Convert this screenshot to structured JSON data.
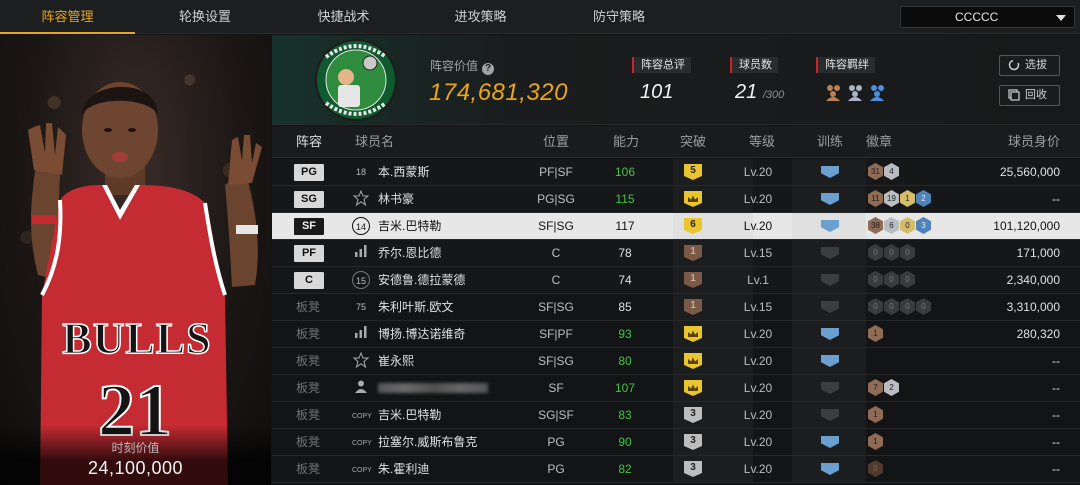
{
  "nav": {
    "tabs": [
      {
        "label": "阵容管理",
        "active": true
      },
      {
        "label": "轮换设置",
        "active": false
      },
      {
        "label": "快捷战术",
        "active": false
      },
      {
        "label": "进攻策略",
        "active": false
      },
      {
        "label": "防守策略",
        "active": false
      }
    ],
    "team_select": "CCCCC"
  },
  "player_card": {
    "jersey_number": "21",
    "team_word": "BULLS",
    "label": "时刻价值",
    "value": "24,100,000"
  },
  "header": {
    "value_label": "阵容价值",
    "team_value": "174,681,320",
    "overall_label": "阵容总评",
    "overall": "101",
    "players_label": "球员数",
    "players": "21",
    "players_max": "/300",
    "chemistry_label": "阵容羁绊",
    "pick_button": "选拔",
    "recycle_button": "回收",
    "accent_color": "#e9a51c"
  },
  "table": {
    "headers": [
      "阵容",
      "球员名",
      "位置",
      "能力",
      "突破",
      "等级",
      "训练",
      "徽章",
      "球员身价"
    ],
    "rows": [
      {
        "slot": "PG",
        "starter": true,
        "num": "18",
        "numStyle": "plain",
        "name": "本.西蒙斯",
        "pos": "PF|SF",
        "ability": "106",
        "abilityGreen": true,
        "bt": "5",
        "btColor": "gold",
        "level": "Lv.20",
        "train": "blue",
        "badges": [
          [
            "31",
            "bronze"
          ],
          [
            "4",
            "silver"
          ]
        ],
        "value": "25,560,000"
      },
      {
        "slot": "SG",
        "starter": true,
        "num": "star",
        "numStyle": "star",
        "name": "林书豪",
        "pos": "PG|SG",
        "ability": "115",
        "abilityGreen": true,
        "bt": "crown",
        "btColor": "gold",
        "level": "Lv.20",
        "train": "blue",
        "badges": [
          [
            "11",
            "bronze"
          ],
          [
            "19",
            "silver"
          ],
          [
            "1",
            "gold"
          ],
          [
            "2",
            "blue"
          ]
        ],
        "value": "--"
      },
      {
        "slot": "SF",
        "starter": true,
        "selected": true,
        "num": "14",
        "numStyle": "circle",
        "name": "吉米.巴特勒",
        "pos": "SF|SG",
        "ability": "117",
        "abilityGreen": false,
        "bt": "6",
        "btColor": "gold",
        "level": "Lv.20",
        "train": "blue",
        "badges": [
          [
            "38",
            "bronze"
          ],
          [
            "6",
            "silver"
          ],
          [
            "0",
            "gold"
          ],
          [
            "3",
            "blue"
          ]
        ],
        "value": "101,120,000"
      },
      {
        "slot": "PF",
        "starter": true,
        "num": "bars",
        "numStyle": "bars",
        "name": "乔尔.恩比德",
        "pos": "C",
        "ability": "78",
        "abilityGreen": false,
        "bt": "1",
        "btColor": "brown",
        "level": "Lv.15",
        "train": "dim",
        "badges": [
          [
            "0",
            "dark"
          ],
          [
            "0",
            "dark"
          ],
          [
            "0",
            "dark"
          ]
        ],
        "value": "171,000"
      },
      {
        "slot": "C",
        "starter": true,
        "num": "15",
        "numStyle": "circle",
        "name": "安德鲁.德拉蒙德",
        "pos": "C",
        "ability": "74",
        "abilityGreen": false,
        "bt": "1",
        "btColor": "brown",
        "level": "Lv.1",
        "train": "dim",
        "badges": [
          [
            "0",
            "dark"
          ],
          [
            "0",
            "dark"
          ],
          [
            "0",
            "dark"
          ]
        ],
        "value": "2,340,000"
      },
      {
        "slot": "板凳",
        "starter": false,
        "num": "75",
        "numStyle": "plain",
        "name": "朱利叶斯.欧文",
        "pos": "SF|SG",
        "ability": "85",
        "abilityGreen": false,
        "bt": "1",
        "btColor": "brown",
        "level": "Lv.15",
        "train": "dim",
        "badges": [
          [
            "0",
            "dark"
          ],
          [
            "0",
            "dark"
          ],
          [
            "0",
            "dark"
          ],
          [
            "0",
            "dark"
          ]
        ],
        "value": "3,310,000"
      },
      {
        "slot": "板凳",
        "starter": false,
        "num": "bars",
        "numStyle": "bars",
        "name": "博扬.博达诺维奇",
        "pos": "SF|PF",
        "ability": "93",
        "abilityGreen": true,
        "bt": "crown",
        "btColor": "gold",
        "level": "Lv.20",
        "train": "blue",
        "badges": [
          [
            "1",
            "bronze"
          ]
        ],
        "value": "280,320"
      },
      {
        "slot": "板凳",
        "starter": false,
        "num": "star",
        "numStyle": "star",
        "name": "崔永熙",
        "pos": "SF|SG",
        "ability": "80",
        "abilityGreen": true,
        "bt": "crown",
        "btColor": "gold",
        "level": "Lv.20",
        "train": "blue",
        "badges": [],
        "value": "--"
      },
      {
        "slot": "板凳",
        "starter": false,
        "num": "person",
        "numStyle": "person",
        "name": "",
        "blurred": true,
        "pos": "SF",
        "ability": "107",
        "abilityGreen": true,
        "bt": "crown",
        "btColor": "gold",
        "level": "Lv.20",
        "train": "dim",
        "badges": [
          [
            "7",
            "bronze"
          ],
          [
            "2",
            "silver"
          ]
        ],
        "value": "--"
      },
      {
        "slot": "板凳",
        "starter": false,
        "num": "COPY",
        "numStyle": "copy",
        "name": "吉米.巴特勒",
        "pos": "SG|SF",
        "ability": "83",
        "abilityGreen": true,
        "bt": "3",
        "btColor": "grey",
        "level": "Lv.20",
        "train": "dim",
        "badges": [
          [
            "1",
            "bronze"
          ]
        ],
        "value": "--"
      },
      {
        "slot": "板凳",
        "starter": false,
        "num": "COPY",
        "numStyle": "copy",
        "name": "拉塞尔.威斯布鲁克",
        "pos": "PG",
        "ability": "90",
        "abilityGreen": true,
        "bt": "3",
        "btColor": "grey",
        "level": "Lv.20",
        "train": "blue",
        "badges": [
          [
            "1",
            "bronze"
          ]
        ],
        "value": "--"
      },
      {
        "slot": "板凳",
        "starter": false,
        "num": "COPY",
        "numStyle": "copy",
        "name": "朱.霍利迪",
        "pos": "PG",
        "ability": "82",
        "abilityGreen": true,
        "bt": "3",
        "btColor": "grey",
        "level": "Lv.20",
        "train": "blue",
        "badges": [
          [
            "0",
            "darkbronze"
          ]
        ],
        "value": "--"
      }
    ]
  }
}
